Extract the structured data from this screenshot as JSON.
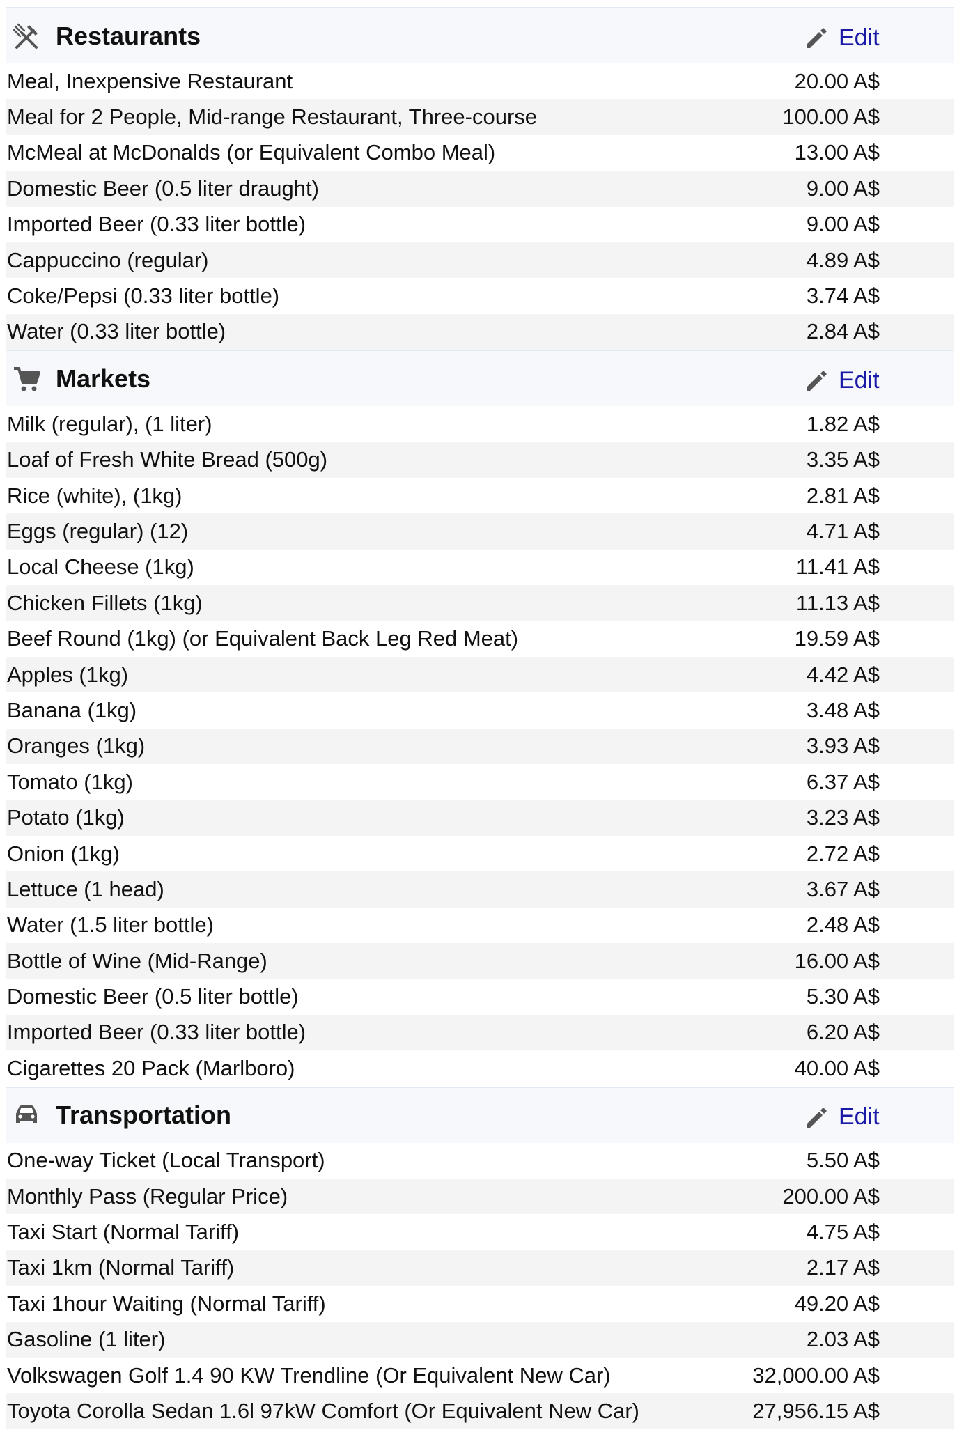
{
  "sections": [
    {
      "title": "Restaurants",
      "icon": "fork-knife-icon",
      "edit_label": "Edit",
      "rows": [
        {
          "item": "Meal, Inexpensive Restaurant",
          "price": "20.00 A$"
        },
        {
          "item": "Meal for 2 People, Mid-range Restaurant, Three-course",
          "price": "100.00 A$"
        },
        {
          "item": "McMeal at McDonalds (or Equivalent Combo Meal)",
          "price": "13.00 A$"
        },
        {
          "item": "Domestic Beer (0.5 liter draught)",
          "price": "9.00 A$"
        },
        {
          "item": "Imported Beer (0.33 liter bottle)",
          "price": "9.00 A$"
        },
        {
          "item": "Cappuccino (regular)",
          "price": "4.89 A$"
        },
        {
          "item": "Coke/Pepsi (0.33 liter bottle)",
          "price": "3.74 A$"
        },
        {
          "item": "Water (0.33 liter bottle)",
          "price": "2.84 A$"
        }
      ]
    },
    {
      "title": "Markets",
      "icon": "shopping-cart-icon",
      "edit_label": "Edit",
      "rows": [
        {
          "item": "Milk (regular), (1 liter)",
          "price": "1.82 A$"
        },
        {
          "item": "Loaf of Fresh White Bread (500g)",
          "price": "3.35 A$"
        },
        {
          "item": "Rice (white), (1kg)",
          "price": "2.81 A$"
        },
        {
          "item": "Eggs (regular) (12)",
          "price": "4.71 A$"
        },
        {
          "item": "Local Cheese (1kg)",
          "price": "11.41 A$"
        },
        {
          "item": "Chicken Fillets (1kg)",
          "price": "11.13 A$"
        },
        {
          "item": "Beef Round (1kg) (or Equivalent Back Leg Red Meat)",
          "price": "19.59 A$"
        },
        {
          "item": "Apples (1kg)",
          "price": "4.42 A$"
        },
        {
          "item": "Banana (1kg)",
          "price": "3.48 A$"
        },
        {
          "item": "Oranges (1kg)",
          "price": "3.93 A$"
        },
        {
          "item": "Tomato (1kg)",
          "price": "6.37 A$"
        },
        {
          "item": "Potato (1kg)",
          "price": "3.23 A$"
        },
        {
          "item": "Onion (1kg)",
          "price": "2.72 A$"
        },
        {
          "item": "Lettuce (1 head)",
          "price": "3.67 A$"
        },
        {
          "item": "Water (1.5 liter bottle)",
          "price": "2.48 A$"
        },
        {
          "item": "Bottle of Wine (Mid-Range)",
          "price": "16.00 A$"
        },
        {
          "item": "Domestic Beer (0.5 liter bottle)",
          "price": "5.30 A$"
        },
        {
          "item": "Imported Beer (0.33 liter bottle)",
          "price": "6.20 A$"
        },
        {
          "item": "Cigarettes 20 Pack (Marlboro)",
          "price": "40.00 A$"
        }
      ]
    },
    {
      "title": "Transportation",
      "icon": "car-icon",
      "edit_label": "Edit",
      "rows": [
        {
          "item": "One-way Ticket (Local Transport)",
          "price": "5.50 A$"
        },
        {
          "item": "Monthly Pass (Regular Price)",
          "price": "200.00 A$"
        },
        {
          "item": "Taxi Start (Normal Tariff)",
          "price": "4.75 A$"
        },
        {
          "item": "Taxi 1km (Normal Tariff)",
          "price": "2.17 A$"
        },
        {
          "item": "Taxi 1hour Waiting (Normal Tariff)",
          "price": "49.20 A$"
        },
        {
          "item": "Gasoline (1 liter)",
          "price": "2.03 A$"
        },
        {
          "item": "Volkswagen Golf 1.4 90 KW Trendline (Or Equivalent New Car)",
          "price": "32,000.00 A$"
        },
        {
          "item": "Toyota Corolla Sedan 1.6l 97kW Comfort (Or Equivalent New Car)",
          "price": "27,956.15 A$"
        }
      ]
    }
  ]
}
